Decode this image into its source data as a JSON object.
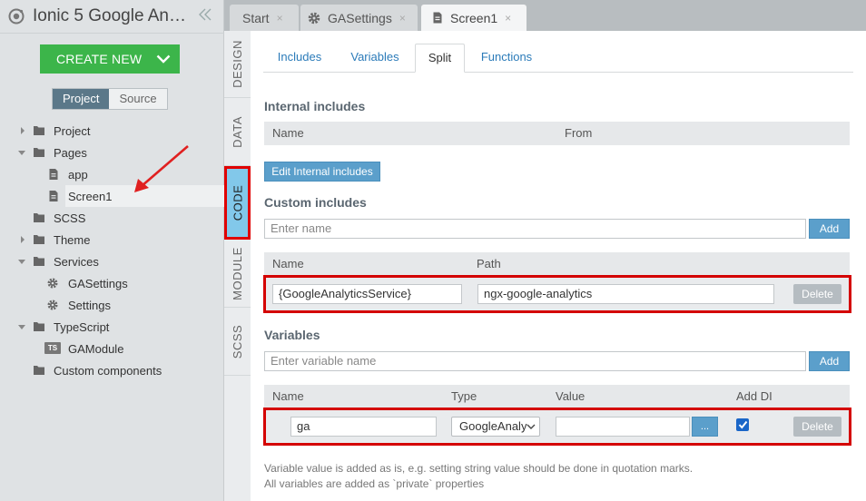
{
  "app": {
    "title": "Ionic 5 Google Ana...",
    "collapse_icon": "double-chevron-left-icon"
  },
  "create": {
    "label": "CREATE NEW",
    "color": "#3cb54a"
  },
  "segment": {
    "project": "Project",
    "source": "Source"
  },
  "tree": [
    {
      "label": "Project",
      "icon": "folder-icon",
      "expandable": true
    },
    {
      "label": "Pages",
      "icon": "folder-icon",
      "expanded": true
    },
    {
      "label": "app",
      "icon": "page-icon"
    },
    {
      "label": "Screen1",
      "icon": "page-icon",
      "selected": true
    },
    {
      "label": "SCSS",
      "icon": "folder-icon"
    },
    {
      "label": "Theme",
      "icon": "folder-icon",
      "expandable": true
    },
    {
      "label": "Services",
      "icon": "folder-icon",
      "expanded": true
    },
    {
      "label": "GASettings",
      "icon": "gear-icon"
    },
    {
      "label": "Settings",
      "icon": "gear-icon"
    },
    {
      "label": "TypeScript",
      "icon": "folder-icon",
      "expanded": true
    },
    {
      "label": "GAModule",
      "icon": "ts-icon",
      "badge": "TS"
    },
    {
      "label": "Custom components",
      "icon": "folder-icon"
    }
  ],
  "vtabs": [
    {
      "label": "DESIGN"
    },
    {
      "label": "DATA"
    },
    {
      "label": "CODE",
      "active": true
    },
    {
      "label": "MODULE"
    },
    {
      "label": "SCSS"
    }
  ],
  "file_tabs": [
    {
      "label": "Start",
      "close": "×"
    },
    {
      "label": "GASettings",
      "close": "×",
      "icon": "gear-icon"
    },
    {
      "label": "Screen1",
      "close": "×",
      "icon": "page-icon",
      "active": true
    }
  ],
  "subtabs": [
    {
      "label": "Includes"
    },
    {
      "label": "Variables"
    },
    {
      "label": "Split",
      "active": true
    },
    {
      "label": "Functions"
    }
  ],
  "internal": {
    "title": "Internal includes",
    "col_name": "Name",
    "col_from": "From",
    "edit_button": "Edit Internal includes"
  },
  "custom": {
    "title": "Custom includes",
    "name_placeholder": "Enter name",
    "add_button": "Add",
    "col_name": "Name",
    "col_path": "Path",
    "row": {
      "name": "{GoogleAnalyticsService}",
      "path": "ngx-google-analytics",
      "delete": "Delete"
    }
  },
  "variables": {
    "title": "Variables",
    "name_placeholder": "Enter variable name",
    "add_button": "Add",
    "col_name": "Name",
    "col_type": "Type",
    "col_value": "Value",
    "col_add_di": "Add DI",
    "row": {
      "name": "ga",
      "type": "GoogleAnaly",
      "value": "",
      "more": "...",
      "add_di": true,
      "delete": "Delete"
    },
    "note_line1": "Variable value is added as is, e.g. setting string value should be done in quotation marks.",
    "note_line2": "All variables are added as `private` properties"
  },
  "colors": {
    "highlight_red": "#d40000",
    "active_vtab": "#82c8ea",
    "link_blue": "#2b7bb9"
  }
}
